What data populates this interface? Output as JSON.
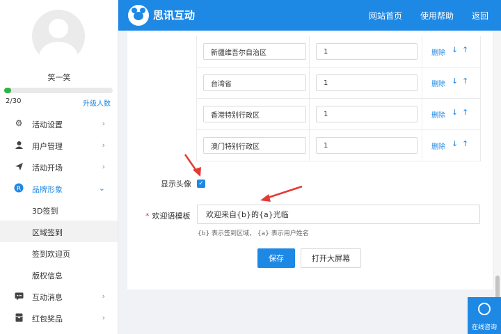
{
  "sidebar": {
    "username": "笑一笑",
    "progress_text": "2/30",
    "progress_fraction": 0.067,
    "upgrade_label": "升级人数",
    "menu": [
      {
        "label": "活动设置",
        "icon": "gear-icon"
      },
      {
        "label": "用户管理",
        "icon": "user-icon"
      },
      {
        "label": "活动开场",
        "icon": "send-icon"
      },
      {
        "label": "品牌形象",
        "icon": "brand-r-icon"
      },
      {
        "label": "互动消息",
        "icon": "chat-icon"
      },
      {
        "label": "红包奖品",
        "icon": "envelope-icon"
      }
    ],
    "submenu": [
      {
        "label": "3D签到"
      },
      {
        "label": "区域签到"
      },
      {
        "label": "签到欢迎页"
      },
      {
        "label": "版权信息"
      }
    ]
  },
  "header": {
    "brand": "思讯互动",
    "nav": [
      "网站首页",
      "使用帮助",
      "返回"
    ]
  },
  "regions": [
    {
      "name": "新疆维吾尔自治区",
      "num": "1"
    },
    {
      "name": "台湾省",
      "num": "1"
    },
    {
      "name": "香港特别行政区",
      "num": "1"
    },
    {
      "name": "澳门特别行政区",
      "num": "1"
    }
  ],
  "row_actions": {
    "delete": "删除",
    "down": "↓",
    "up": "↑"
  },
  "form": {
    "show_avatar_label": "显示头像",
    "show_avatar_checked": true,
    "required_mark": "*",
    "template_label": "欢迎语模板",
    "template_value": "欢迎来自{b}的{a}光临",
    "template_hint": "{b} 表示签到区域， {a} 表示用户姓名",
    "save_label": "保存",
    "bigscreen_label": "打开大屏幕"
  },
  "consult": {
    "label": "在线咨询"
  },
  "colors": {
    "primary": "#1e88e5",
    "progress": "#2fb544",
    "annotation": "#e53935"
  }
}
